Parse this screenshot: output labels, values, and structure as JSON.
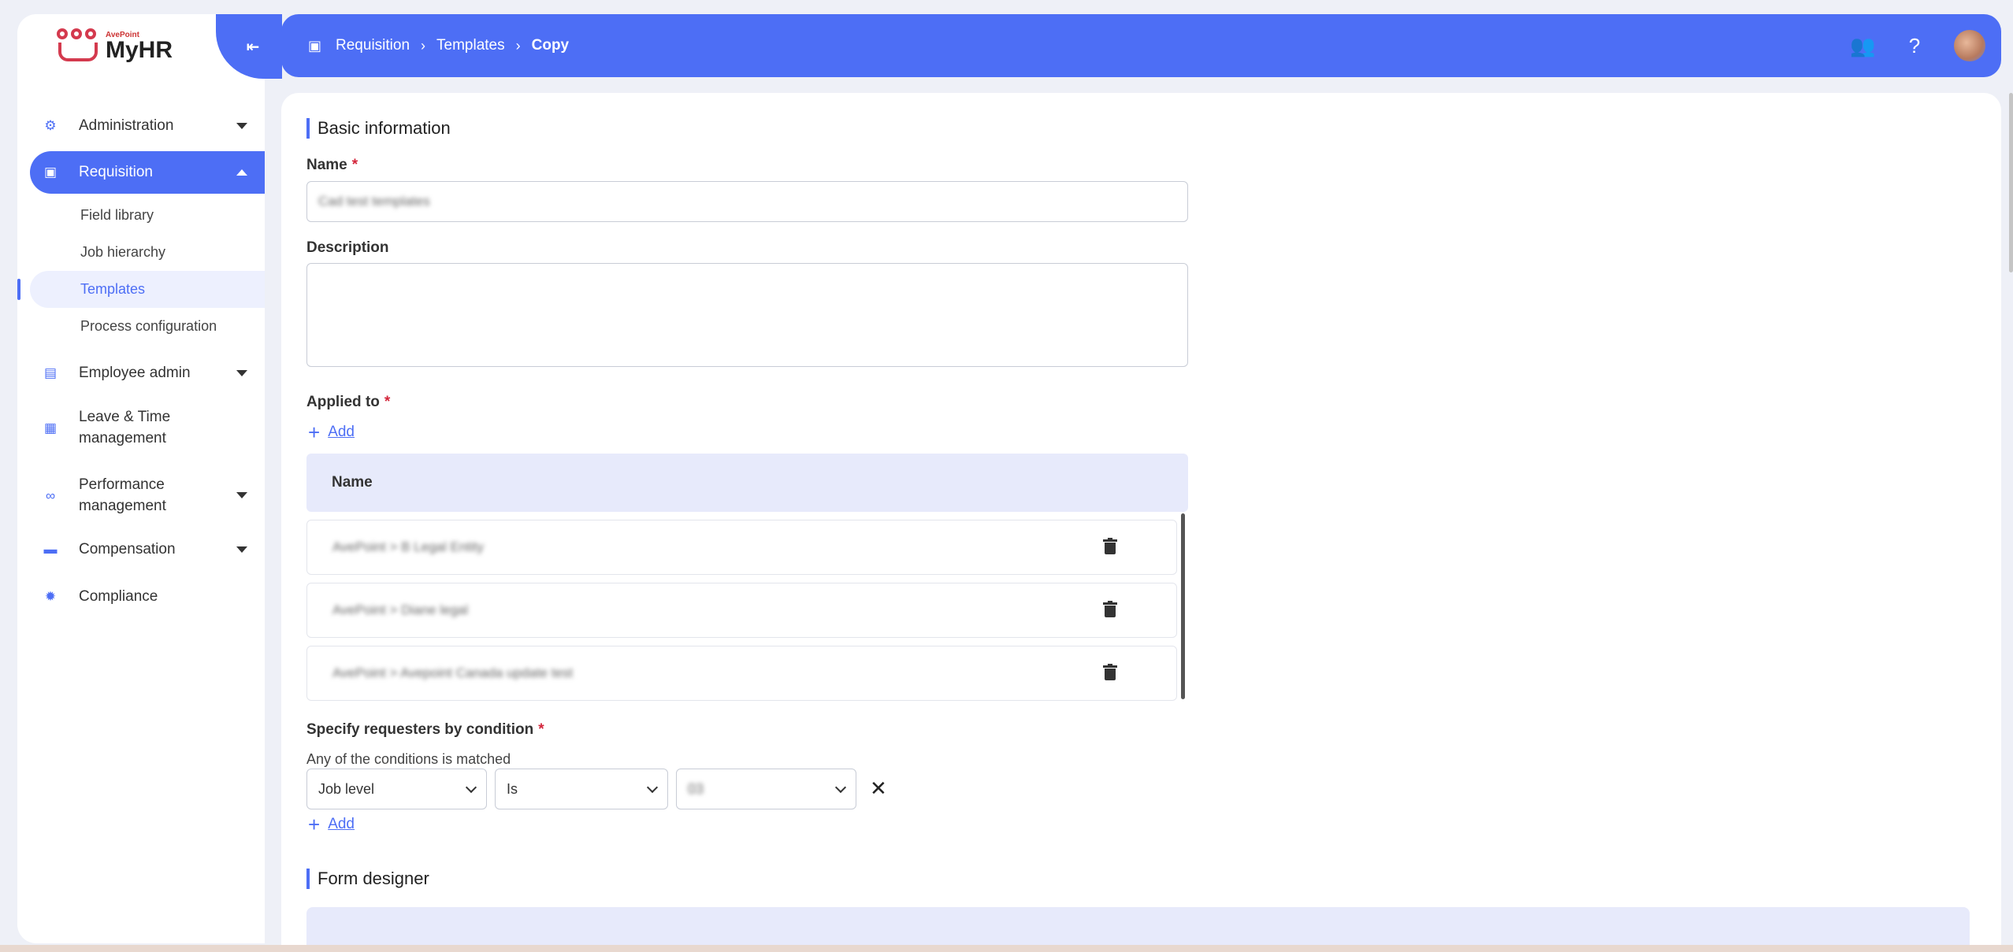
{
  "sidebar": {
    "logo_small": "AvePoint",
    "logo_text": "MyHR",
    "nav": {
      "administration": "Administration",
      "requisition": "Requisition",
      "field_library": "Field library",
      "job_hierarchy": "Job hierarchy",
      "templates": "Templates",
      "process_configuration": "Process configuration",
      "employee_admin": "Employee admin",
      "leave_line1": "Leave & Time",
      "leave_line2": "management",
      "performance_line1": "Performance",
      "performance_line2": "management",
      "compensation": "Compensation",
      "compliance": "Compliance"
    }
  },
  "header": {
    "breadcrumbs": [
      "Requisition",
      "Templates",
      "Copy"
    ]
  },
  "form": {
    "basic_info_title": "Basic information",
    "name_label": "Name",
    "required_mark": "*",
    "name_value": "Cad test templates",
    "description_label": "Description",
    "applied_to_label": "Applied to",
    "add_label": "Add",
    "table_header": "Name",
    "applied_rows": [
      "AvePoint > B Legal Entity",
      "AvePoint > Diane legal",
      "AvePoint > Avepoint Canada update test"
    ],
    "requesters_label": "Specify requesters by condition",
    "conditions_note": "Any of the conditions is matched",
    "condition": {
      "field": "Job level",
      "operator": "Is",
      "value": "03"
    },
    "form_designer_title": "Form designer"
  },
  "colors": {
    "accent": "#4d6ef5",
    "required": "#d3263b",
    "table_header_bg": "#e7eafb"
  }
}
